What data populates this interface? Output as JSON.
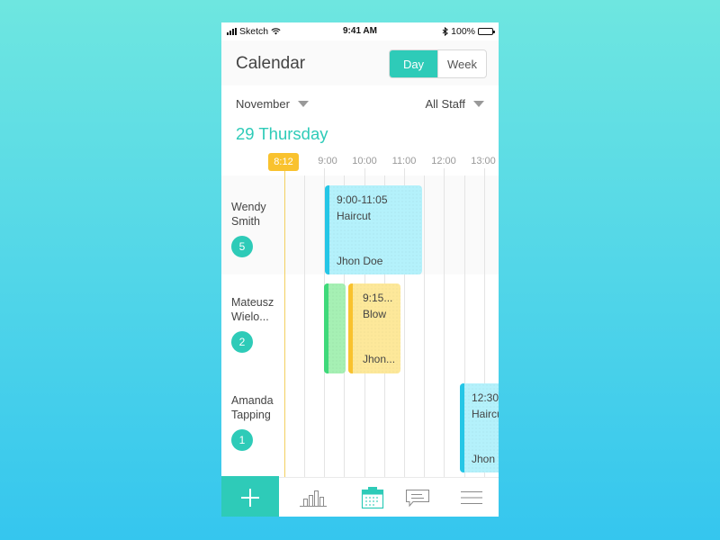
{
  "status_bar": {
    "carrier": "Sketch",
    "time": "9:41 AM",
    "battery": "100%"
  },
  "header": {
    "title": "Calendar",
    "view_toggle": [
      {
        "label": "Day",
        "active": true
      },
      {
        "label": "Week",
        "active": false
      }
    ]
  },
  "filters": {
    "month": "November",
    "staff": "All Staff"
  },
  "date_label": "29 Thursday",
  "timeline": {
    "now_label": "8:12",
    "hours": [
      "9:00",
      "10:00",
      "11:00",
      "12:00",
      "13:00"
    ]
  },
  "staff": [
    {
      "name_line1": "Wendy",
      "name_line2": "Smith",
      "count": "5",
      "events": [
        {
          "time": "9:00-11:05",
          "service": "Haircut",
          "client": "Jhon Doe",
          "color": "cyan"
        }
      ]
    },
    {
      "name_line1": "Mateusz",
      "name_line2": "Wielo...",
      "count": "2",
      "events": [
        {
          "time": "",
          "service": "",
          "client": "",
          "color": "green"
        },
        {
          "time": "9:15...",
          "service": "Blow",
          "client": "Jhon...",
          "color": "yellow"
        }
      ]
    },
    {
      "name_line1": "Amanda",
      "name_line2": "Tapping",
      "count": "1",
      "events": [
        {
          "time": "12:30",
          "service": "Haircut",
          "client": "Jhon Doe",
          "color": "cyan"
        }
      ]
    }
  ],
  "tab_bar": {
    "items": [
      "add",
      "reports",
      "calendar",
      "messages",
      "menu"
    ],
    "active": "calendar"
  },
  "colors": {
    "accent": "#2ecbb8",
    "now": "#f9c22e",
    "event_cyan": "#b4f1fb",
    "event_green": "#a6f0b4",
    "event_yellow": "#fde89a"
  }
}
